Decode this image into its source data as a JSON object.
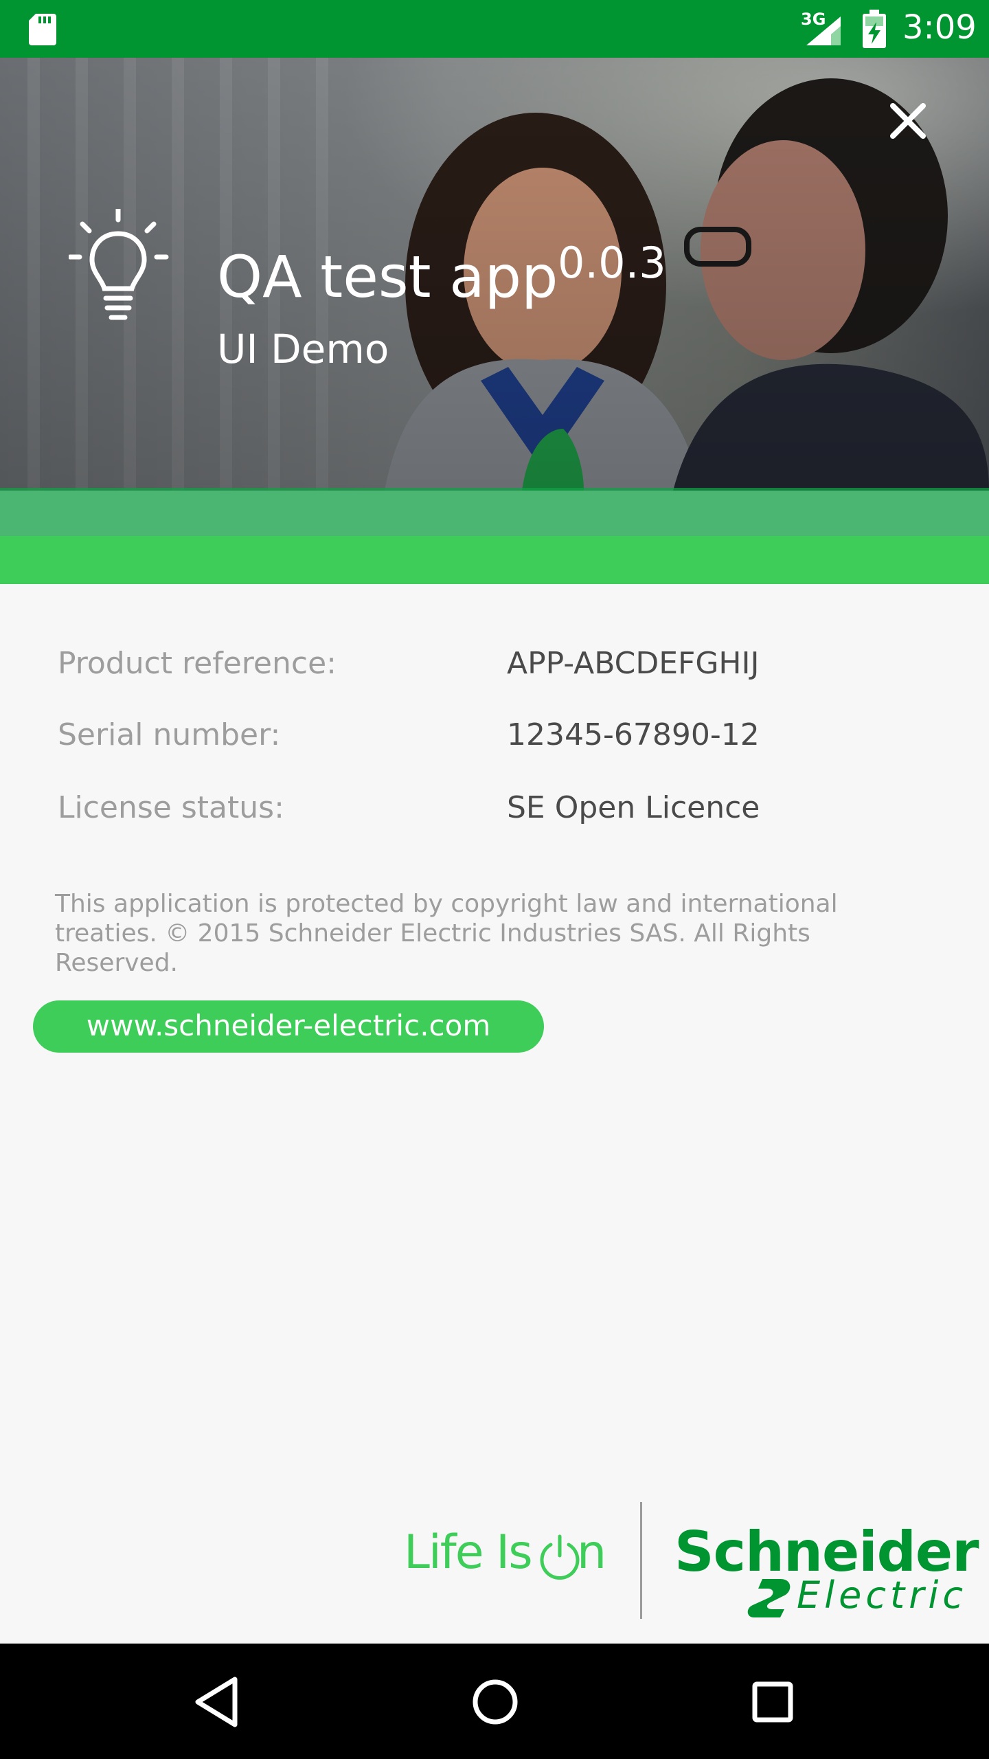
{
  "status_bar": {
    "network": "3G",
    "time": "3:09",
    "icons": [
      "sd-card-icon",
      "signal-icon",
      "battery-charging-icon"
    ]
  },
  "header": {
    "app_name": "QA test app",
    "version": "0.0.3",
    "subtitle": "UI Demo",
    "icons": [
      "lightbulb-icon",
      "close-icon"
    ]
  },
  "info": {
    "rows": [
      {
        "label": "Product reference:",
        "value": "APP-ABCDEFGHIJ"
      },
      {
        "label": "Serial number:",
        "value": "12345-67890-12"
      },
      {
        "label": "License status:",
        "value": "SE Open Licence"
      }
    ],
    "copyright": "This application is protected by copyright law and international treaties. © 2015 Schneider Electric Industries SAS. All Rights Reserved.",
    "website": "www.schneider-electric.com"
  },
  "footer": {
    "tagline_prefix": "Life Is ",
    "tagline_suffix": "n",
    "brand": "Schneider",
    "brand_sub": "Electric"
  },
  "colors": {
    "status_bar": "#009530",
    "accent_green": "#3dcd58",
    "brand_green": "#009530",
    "background": "#f7f7f7",
    "label_gray": "#9d9d9d",
    "value_gray": "#4a4a4a"
  },
  "nav_bar": {
    "icons": [
      "back-icon",
      "home-icon",
      "recents-icon"
    ]
  }
}
